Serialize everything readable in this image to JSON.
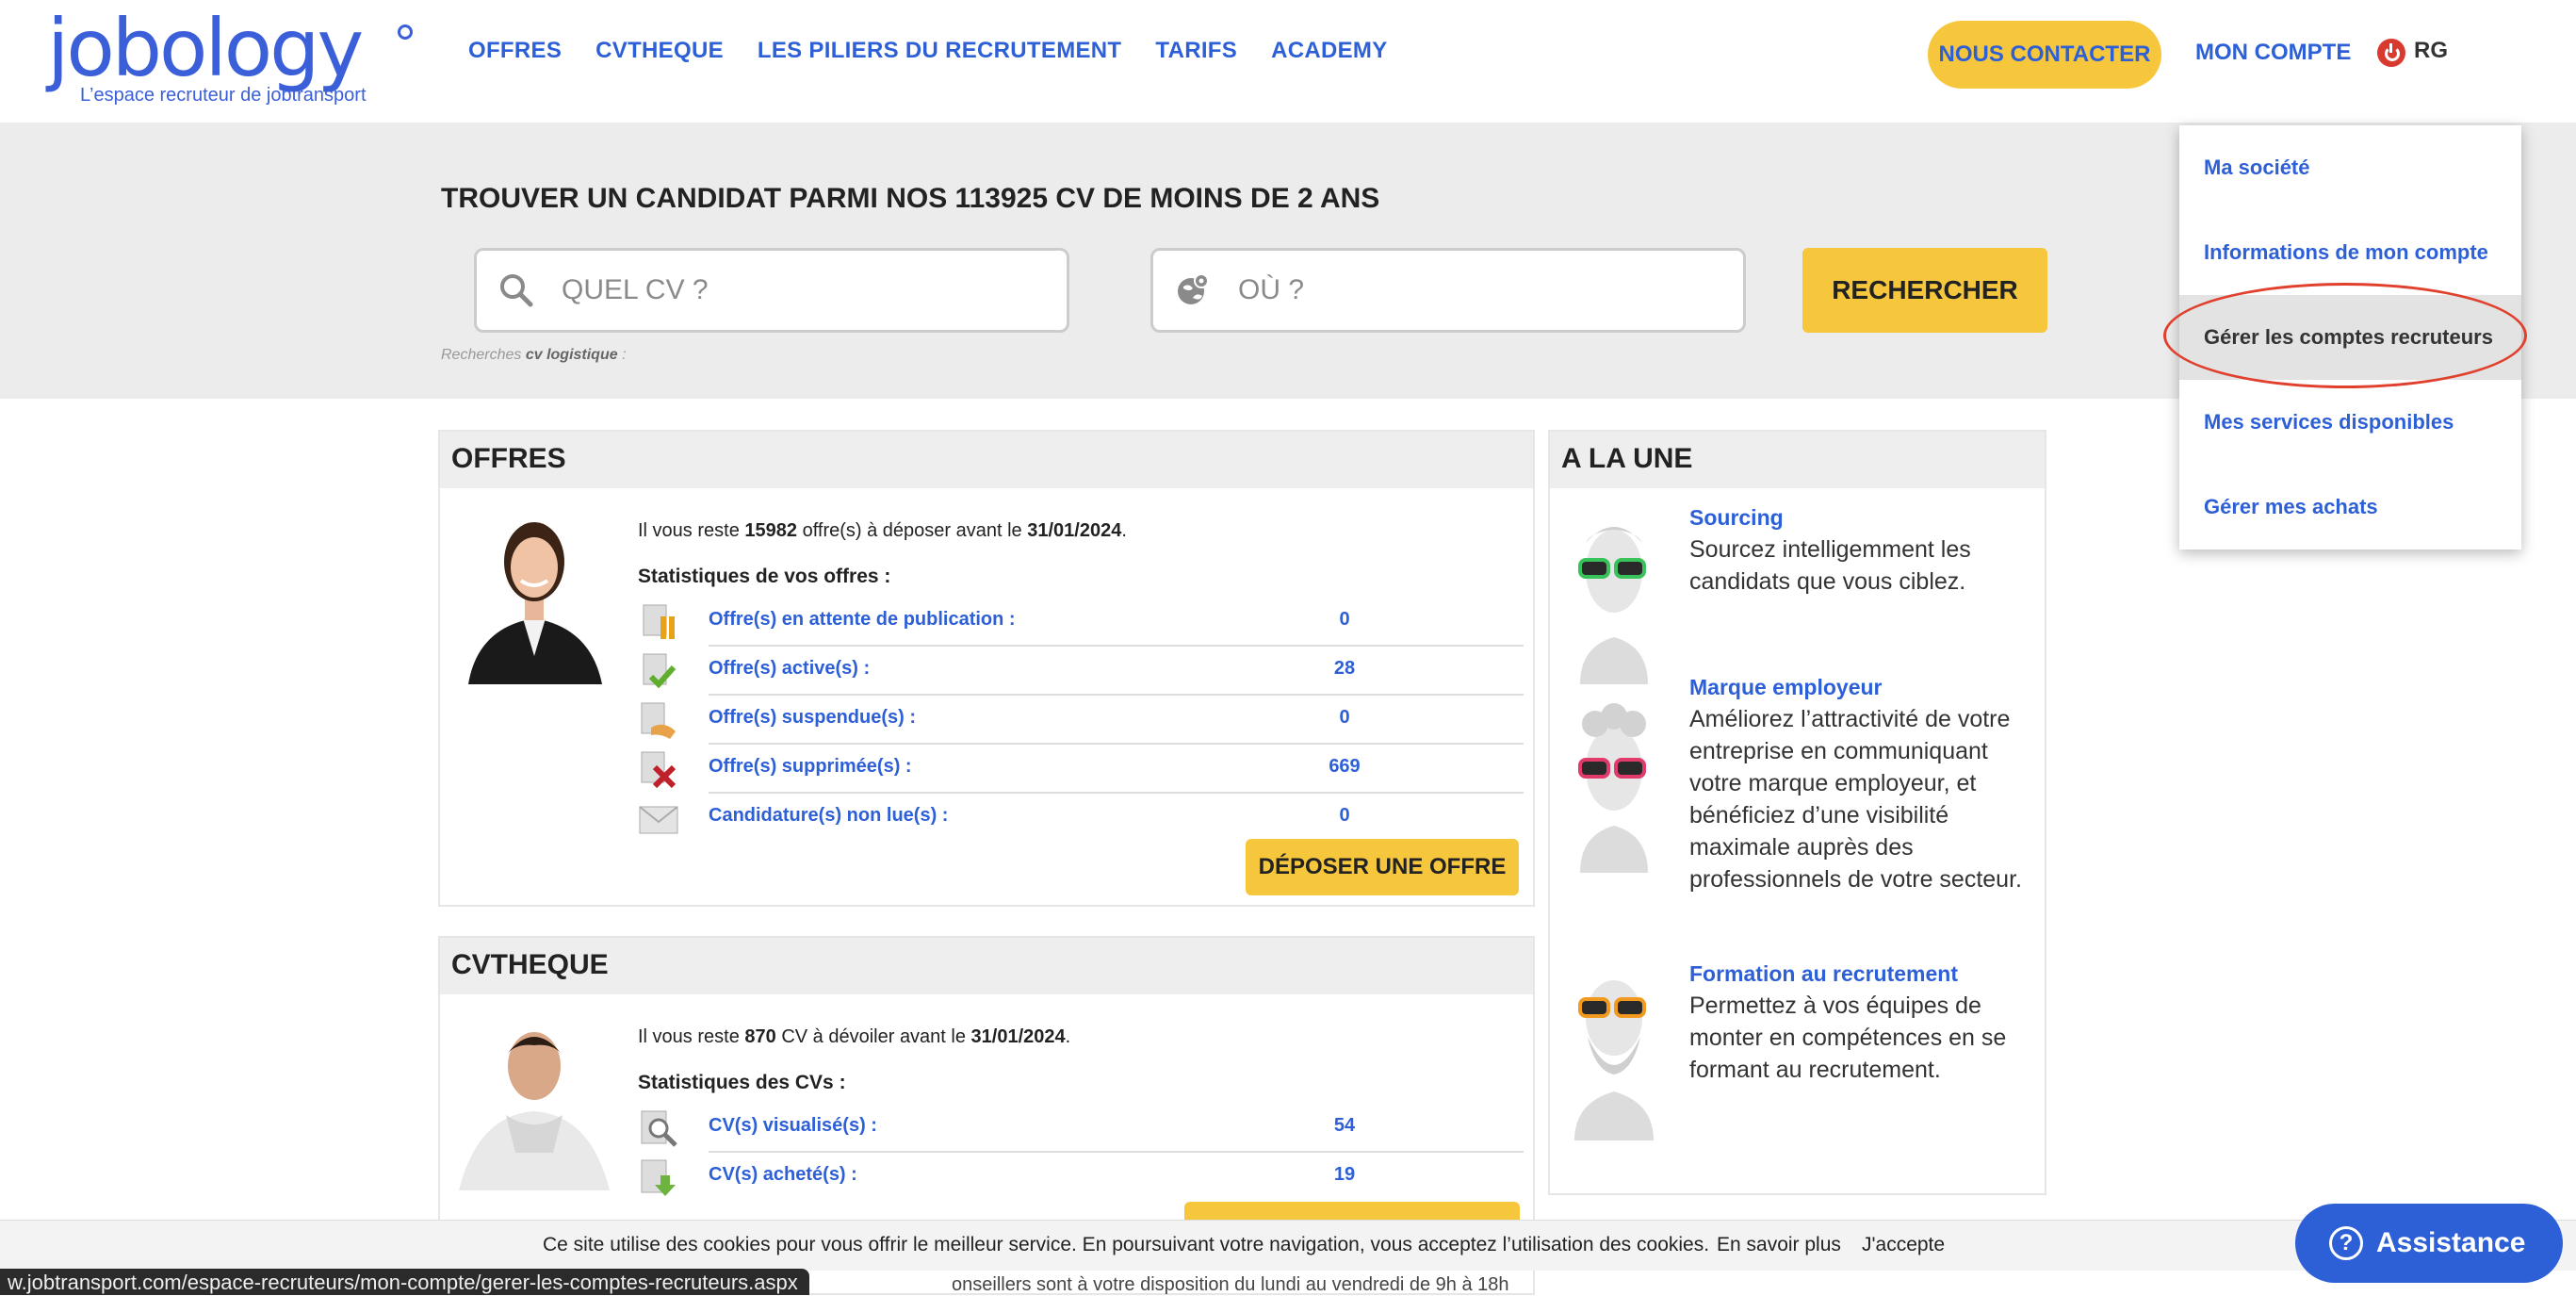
{
  "header": {
    "logo_text": "jobology",
    "logo_tagline": "L’espace recruteur de jobtransport",
    "nav": [
      "OFFRES",
      "CVTHEQUE",
      "LES PILIERS DU RECRUTEMENT",
      "TARIFS",
      "ACADEMY"
    ],
    "contact_label": "NOUS CONTACTER",
    "account_label": "MON COMPTE",
    "user_initials": "RG"
  },
  "search": {
    "title": "TROUVER UN CANDIDAT PARMI NOS 113925 CV DE MOINS DE 2 ANS",
    "what_placeholder": "QUEL CV ?",
    "where_placeholder": "OÙ ?",
    "button_label": "RECHERCHER",
    "recent_prefix": "Recherches",
    "recent_term": "cv logistique",
    "recent_suffix": " :"
  },
  "offres": {
    "title": "OFFRES",
    "info_prefix": "Il vous reste ",
    "info_count": "15982",
    "info_middle": " offre(s) à déposer avant le ",
    "info_date": "31/01/2024",
    "info_end": ".",
    "stats_title": "Statistiques de vos offres :",
    "stats": [
      {
        "label": "Offre(s) en attente de publication :",
        "value": "0",
        "icon": "pending-offer-icon"
      },
      {
        "label": "Offre(s) active(s) :",
        "value": "28",
        "icon": "active-offer-icon"
      },
      {
        "label": "Offre(s) suspendue(s) :",
        "value": "0",
        "icon": "suspended-offer-icon"
      },
      {
        "label": "Offre(s) supprimée(s) :",
        "value": "669",
        "icon": "deleted-offer-icon"
      },
      {
        "label": "Candidature(s) non lue(s) :",
        "value": "0",
        "icon": "unread-application-icon"
      }
    ],
    "button_label": "DÉPOSER UNE OFFRE"
  },
  "cvtheque": {
    "title": "CVTHEQUE",
    "info_prefix": "Il vous reste ",
    "info_count": "870",
    "info_middle": " CV à dévoiler avant le ",
    "info_date": "31/01/2024",
    "info_end": ".",
    "stats_title": "Statistiques des CVs :",
    "stats": [
      {
        "label": "CV(s) visualisé(s) :",
        "value": "54",
        "icon": "viewed-cv-icon"
      },
      {
        "label": "CV(s) acheté(s) :",
        "value": "19",
        "icon": "purchased-cv-icon"
      }
    ]
  },
  "alaune": {
    "title": "A LA UNE",
    "items": [
      {
        "title": "Sourcing",
        "text": "Sourcez intelligemment les candidats que vous ciblez."
      },
      {
        "title": "Marque employeur",
        "text": "Améliorez l’attractivité de votre entreprise en communiquant votre marque employeur, et bénéficiez d’une visibilité maximale auprès des professionnels de votre secteur."
      },
      {
        "title": "Formation au recrutement",
        "text": "Permettez à vos équipes de monter en compétences en se formant au recrutement."
      }
    ]
  },
  "dropdown": {
    "items": [
      "Ma société",
      "Informations de mon compte",
      "Gérer les comptes recruteurs",
      "Mes services disponibles",
      "Gérer mes achats"
    ],
    "active_index": 2
  },
  "cookie": {
    "text": "Ce site utilise des cookies pour vous offrir le meilleur service. En poursuivant votre navigation, vous acceptez l’utilisation des cookies.",
    "more": "En savoir plus",
    "accept": "J'accepte"
  },
  "assistance_label": "Assistance",
  "status_url": "w.jobtransport.com/espace-recruteurs/mon-compte/gerer-les-comptes-recruteurs.aspx",
  "bottom_strip": "onseillers sont à votre disposition du lundi au vendredi de 9h à 18h",
  "colors": {
    "brand_blue": "#2d5fd6",
    "accent_yellow": "#f6c73d",
    "highlight_red": "#e0402c"
  }
}
